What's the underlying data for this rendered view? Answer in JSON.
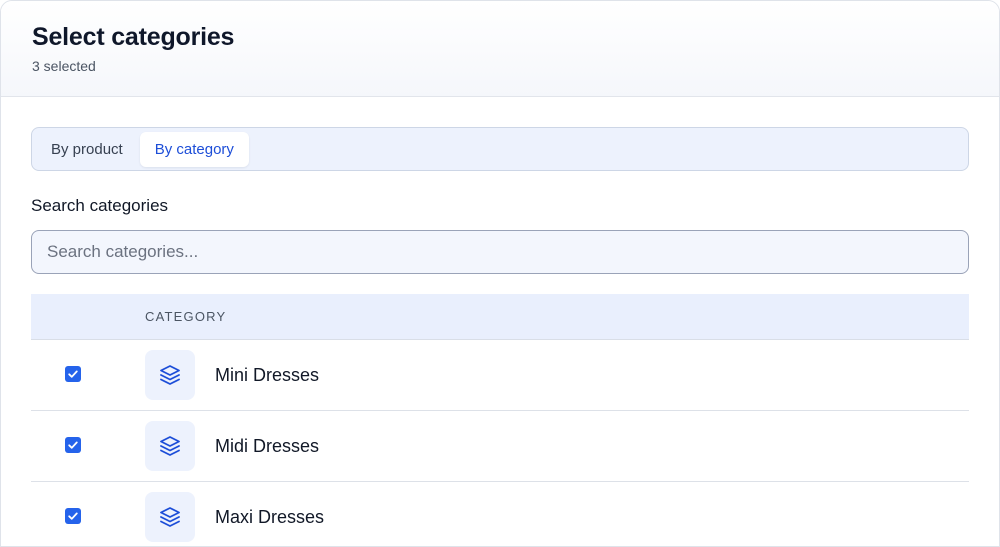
{
  "header": {
    "title": "Select categories",
    "subtitle": "3 selected"
  },
  "tabs": [
    {
      "label": "By product",
      "active": false
    },
    {
      "label": "By category",
      "active": true
    }
  ],
  "search": {
    "label": "Search categories",
    "placeholder": "Search categories...",
    "value": ""
  },
  "table": {
    "column_header": "CATEGORY",
    "rows": [
      {
        "name": "Mini Dresses",
        "checked": true,
        "icon": "layers-icon"
      },
      {
        "name": "Midi Dresses",
        "checked": true,
        "icon": "layers-icon"
      },
      {
        "name": "Maxi Dresses",
        "checked": true,
        "icon": "layers-icon"
      }
    ]
  },
  "colors": {
    "accent": "#2563eb",
    "active_tab_text": "#1d4ed8",
    "tab_bar_bg": "#edf2fd",
    "table_header_bg": "#e9effd"
  }
}
